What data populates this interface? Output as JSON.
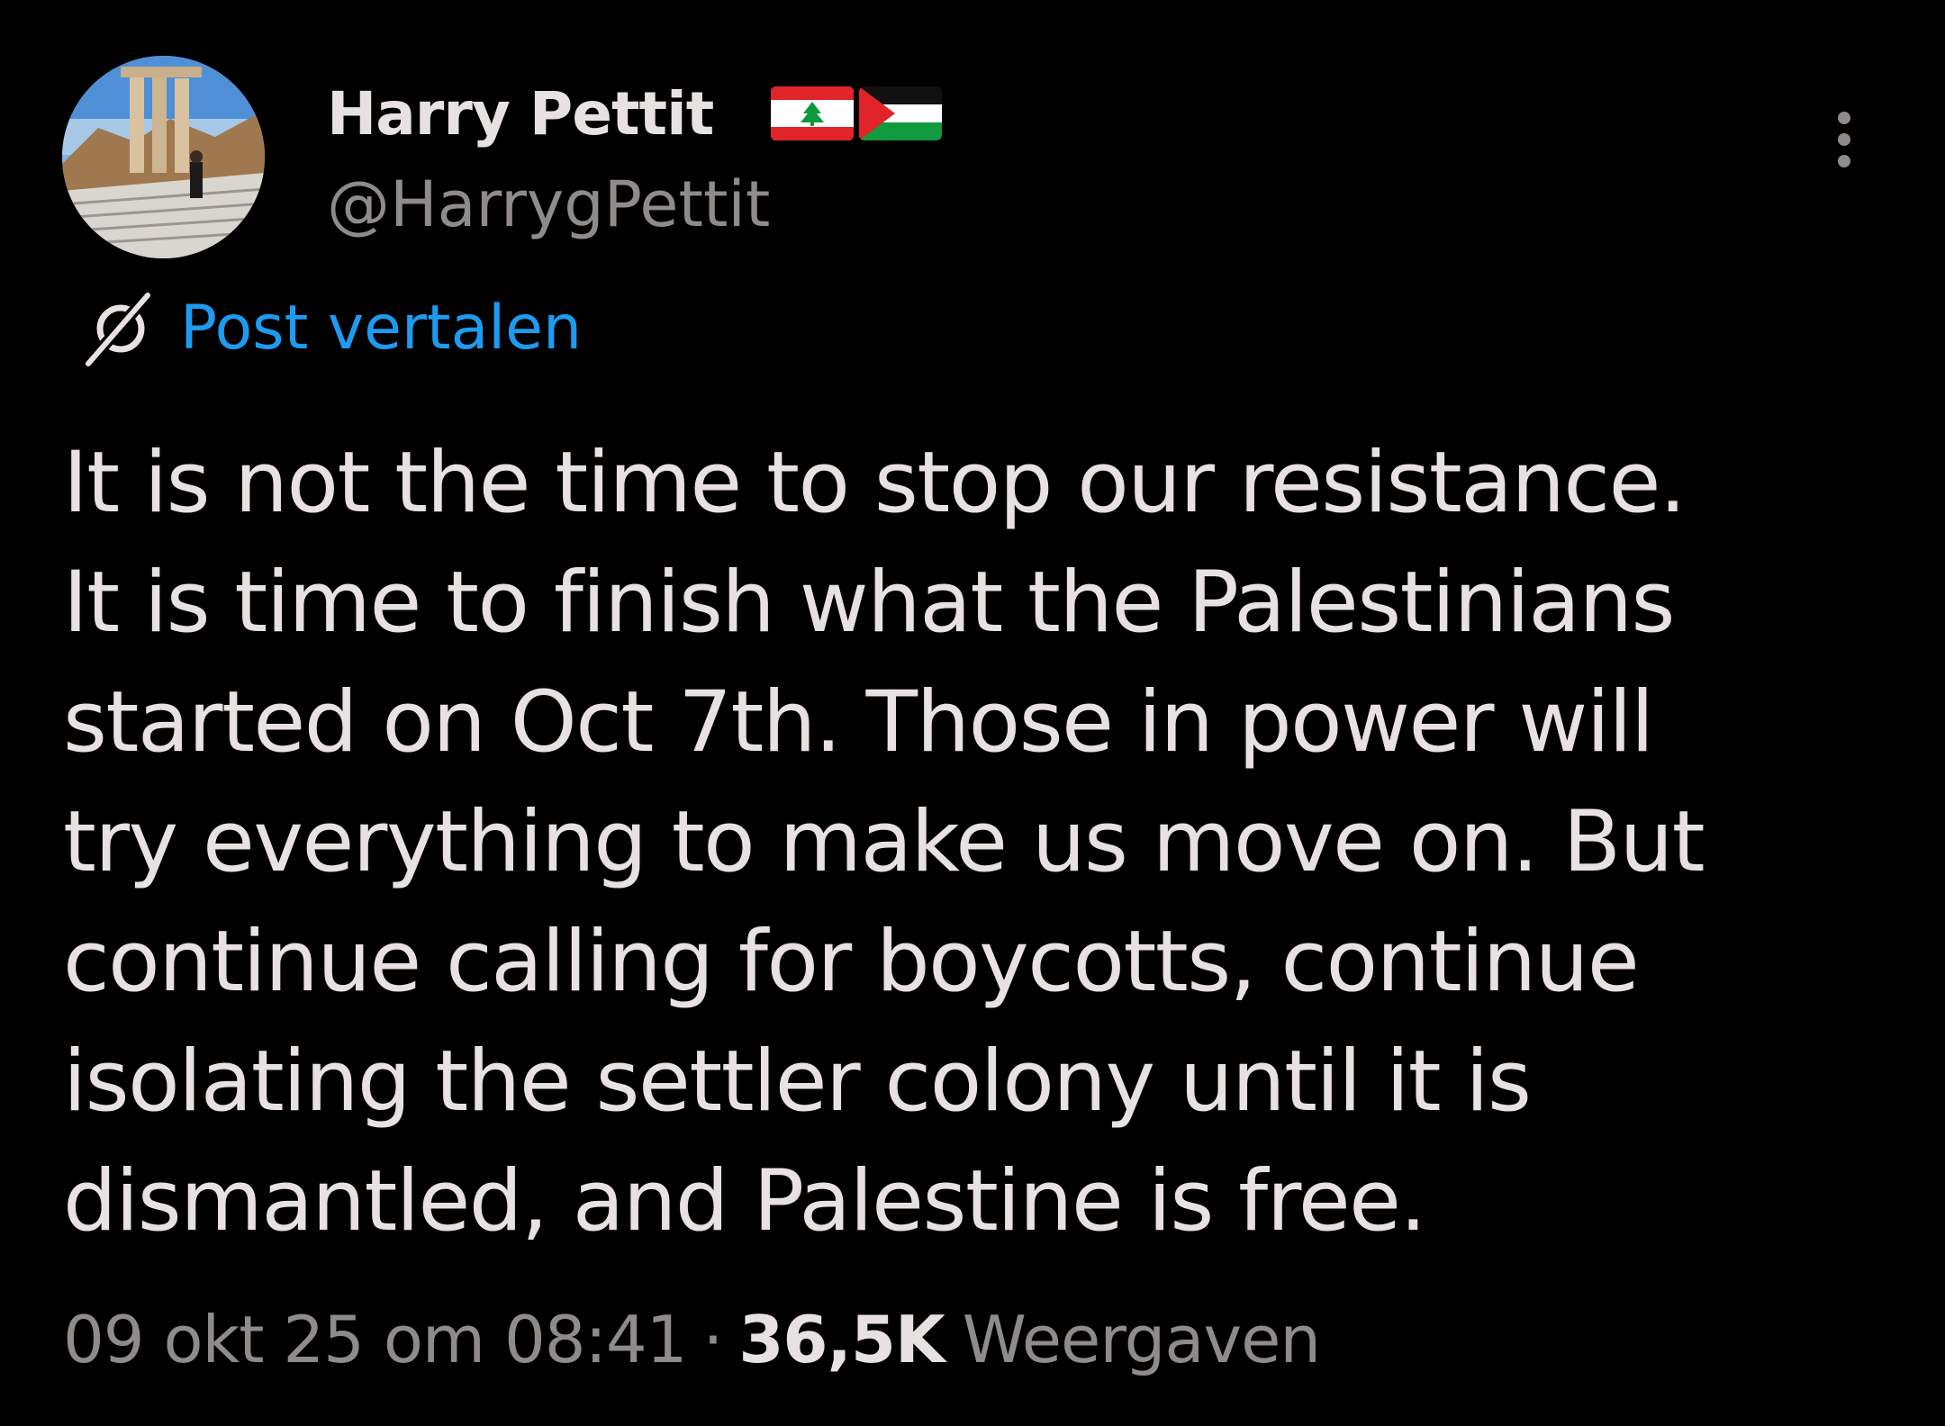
{
  "author": {
    "name": "Harry Pettit",
    "handle": "@HarrygPettit",
    "flags": [
      "lebanon-flag",
      "palestine-flag"
    ]
  },
  "translate": {
    "label": "Post vertalen"
  },
  "tweet": {
    "lines": [
      "It is not the time to stop our resistance.",
      "It is time to finish what the Palestinians",
      "started on Oct 7th. Those in power will",
      "try everything to make us move on. But",
      "continue calling for boycotts, continue",
      "isolating the settler colony until it is",
      "dismantled, and Palestine is free."
    ]
  },
  "meta": {
    "date": "09 okt 25 om 08:41",
    "separator": "·",
    "views_count": "36,5K",
    "views_label": "Weergaven"
  },
  "colors": {
    "background": "#000000",
    "text": "#e7e1e1",
    "secondary": "#8e8a8e",
    "link": "#1d9bf0"
  }
}
